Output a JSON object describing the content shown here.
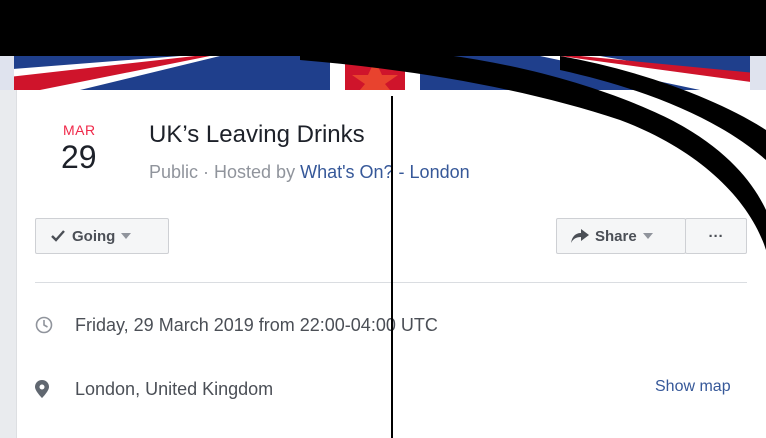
{
  "event": {
    "month": "MAR",
    "day": "29",
    "title": "UK’s Leaving Drinks",
    "privacy_prefix": "Public · Hosted by ",
    "host": "What's On? - London"
  },
  "actions": {
    "going_label": "Going",
    "share_label": "Share",
    "more_label": "···"
  },
  "details": {
    "datetime": "Friday, 29 March 2019 from 22:00-04:00 UTC",
    "location": "London, United Kingdom",
    "show_map": "Show map"
  },
  "icons": {
    "going": "check-icon",
    "share": "share-arrow-icon",
    "time": "clock-icon",
    "location": "map-pin-icon",
    "dropdown": "caret-down-icon"
  },
  "colors": {
    "date_month": "#f02849",
    "link": "#365899",
    "cover_blue": "#1f3f8c",
    "cover_red": "#cf142b"
  }
}
